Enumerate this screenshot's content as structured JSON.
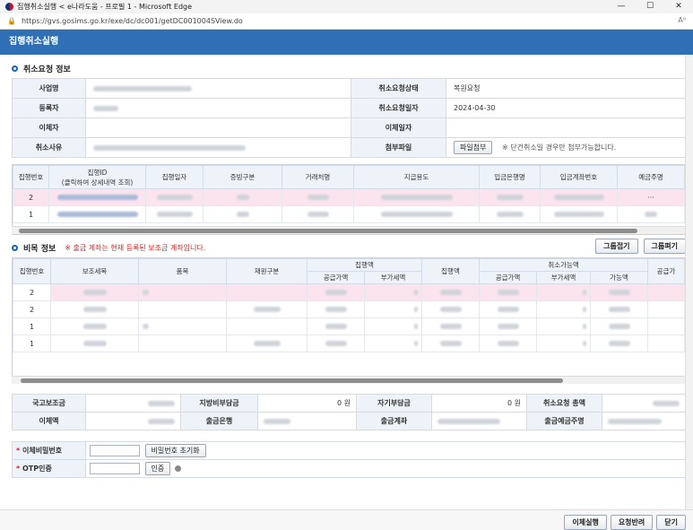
{
  "window": {
    "title": "집행취소실행 < e나라도움 - 프로필 1 - Microsoft Edge",
    "minimize": "—",
    "maximize": "☐",
    "close": "✕"
  },
  "address": {
    "url": "https://gvs.gosims.go.kr/exe/dc/dc001/getDC001004SView.do",
    "reader": "A⁰"
  },
  "header": {
    "title": "집행취소실행"
  },
  "cancel_info": {
    "section_title": "취소요청 정보",
    "labels": {
      "project": "사업명",
      "registrant": "등록자",
      "transferor": "이체자",
      "reason": "취소사유",
      "status": "취소요청상태",
      "request_date": "취소요청일자",
      "transfer_date": "이체일자",
      "attachment": "첨부파일"
    },
    "values": {
      "status": "복원요청",
      "request_date": "2024-04-30",
      "transfer_date": ""
    },
    "attach_button": "파일첨부",
    "attach_note": "※ 단건취소일 경우만 첨부가능합니다."
  },
  "exec_grid": {
    "headers": [
      "집행번호",
      "집행ID\n(클릭하여 상세내역 조회)",
      "집행일자",
      "증빙구분",
      "거래처명",
      "지급용도",
      "입금은행명",
      "입금계좌번호",
      "예금주명"
    ],
    "rows": [
      {
        "no": "2",
        "last": "···"
      },
      {
        "no": "1",
        "last": ""
      }
    ]
  },
  "budget": {
    "section_title": "비목 정보",
    "note": "※ 출금 계좌는 현재 등록된 보조금 계좌입니다.",
    "collapse_all": "그룹접기",
    "expand_all": "그룹펴기",
    "headers": {
      "no": "집행번호",
      "item": "보조세목",
      "subject": "품목",
      "source": "재원구분",
      "exec_amount": "집행액",
      "supply": "공급가액",
      "vat": "부가세액",
      "exec": "집행액",
      "cancelable": "취소가능액",
      "available": "가능액",
      "supply2": "공급가"
    },
    "rows": [
      "2",
      "2",
      "1",
      "1"
    ]
  },
  "summary": {
    "labels": {
      "national": "국고보조금",
      "local": "지방비부담금",
      "self": "자기부담금",
      "total": "취소요청 총액",
      "transfer_amount": "이체액",
      "bank": "출금은행",
      "account": "출금계좌",
      "holder": "출금예금주명"
    },
    "local_value": "0 원",
    "self_value": "0 원"
  },
  "auth": {
    "pw_label": "이체비밀번호",
    "pw_reset": "비밀번호 초기화",
    "otp_label": "OTP인증",
    "otp_button": "인증"
  },
  "footer": {
    "execute": "이체실행",
    "reject": "요청반려",
    "close": "닫기"
  }
}
